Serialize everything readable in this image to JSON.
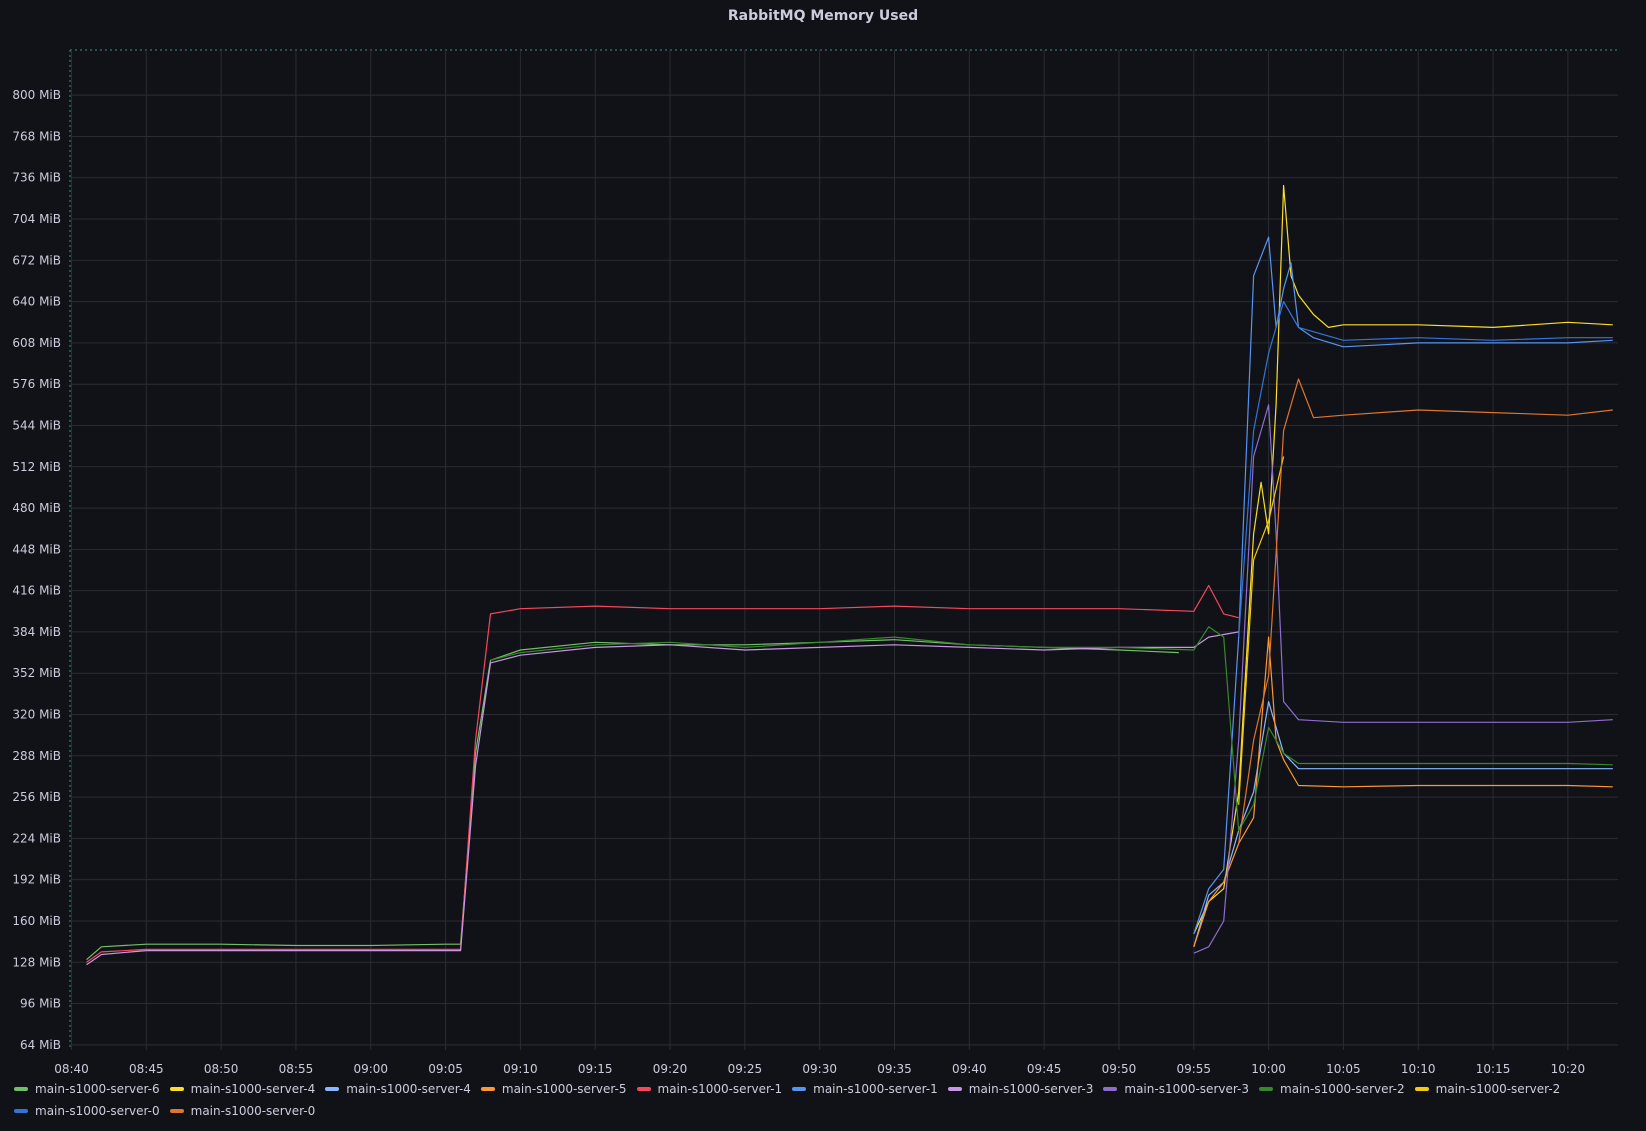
{
  "chart_data": {
    "type": "line",
    "title": "RabbitMQ Memory Used",
    "xlabel": "",
    "ylabel": "",
    "unit": "MiB",
    "ylim": [
      60,
      835
    ],
    "y_ticks": [
      "64 MiB",
      "96 MiB",
      "128 MiB",
      "160 MiB",
      "192 MiB",
      "224 MiB",
      "256 MiB",
      "288 MiB",
      "320 MiB",
      "352 MiB",
      "384 MiB",
      "416 MiB",
      "448 MiB",
      "480 MiB",
      "512 MiB",
      "544 MiB",
      "576 MiB",
      "608 MiB",
      "640 MiB",
      "672 MiB",
      "704 MiB",
      "736 MiB",
      "768 MiB",
      "800 MiB"
    ],
    "y_tick_values": [
      64,
      96,
      128,
      160,
      192,
      224,
      256,
      288,
      320,
      352,
      384,
      416,
      448,
      480,
      512,
      544,
      576,
      608,
      640,
      672,
      704,
      736,
      768,
      800
    ],
    "xlim": [
      "08:40",
      "10:23"
    ],
    "x_ticks": [
      "08:40",
      "08:45",
      "08:50",
      "08:55",
      "09:00",
      "09:05",
      "09:10",
      "09:15",
      "09:20",
      "09:25",
      "09:30",
      "09:35",
      "09:40",
      "09:45",
      "09:50",
      "09:55",
      "10:00",
      "10:05",
      "10:10",
      "10:15",
      "10:20"
    ],
    "grid": true,
    "legend_position": "bottom",
    "series": [
      {
        "name": "main-s1000-server-6",
        "color": "#73bf69",
        "x": [
          "08:41",
          "08:42",
          "08:45",
          "08:50",
          "08:55",
          "09:00",
          "09:05",
          "09:06",
          "09:07",
          "09:08",
          "09:10",
          "09:15",
          "09:20",
          "09:25",
          "09:30",
          "09:35",
          "09:40",
          "09:45",
          "09:50",
          "09:54"
        ],
        "values": [
          130,
          140,
          142,
          142,
          141,
          141,
          142,
          142,
          290,
          362,
          370,
          376,
          374,
          374,
          376,
          378,
          374,
          372,
          370,
          368
        ]
      },
      {
        "name": "main-s1000-server-4",
        "color": "#fade2a",
        "x": [
          "09:55",
          "09:56",
          "09:57",
          "09:58",
          "09:59",
          "09:59.5",
          "10:00",
          "10:00.5",
          "10:01",
          "10:01.5",
          "10:02",
          "10:03",
          "10:04",
          "10:05",
          "10:10",
          "10:15",
          "10:20",
          "10:23"
        ],
        "values": [
          150,
          175,
          185,
          260,
          460,
          500,
          460,
          560,
          730,
          660,
          645,
          630,
          620,
          622,
          622,
          620,
          624,
          622
        ]
      },
      {
        "name": "main-s1000-server-4",
        "color": "#8ab8ff",
        "x": [
          "09:55",
          "09:56",
          "09:57",
          "09:58",
          "09:59",
          "10:00",
          "10:01",
          "10:02",
          "10:05",
          "10:10",
          "10:15",
          "10:20",
          "10:23"
        ],
        "values": [
          140,
          180,
          190,
          230,
          260,
          330,
          290,
          278,
          278,
          278,
          278,
          278,
          278
        ]
      },
      {
        "name": "main-s1000-server-5",
        "color": "#ff9830",
        "x": [
          "09:55",
          "09:56",
          "09:57",
          "09:58",
          "09:59",
          "10:00",
          "10:00.5",
          "10:01",
          "10:02",
          "10:05",
          "10:10",
          "10:15",
          "10:20",
          "10:23"
        ],
        "values": [
          140,
          175,
          190,
          220,
          240,
          380,
          300,
          285,
          265,
          264,
          265,
          265,
          265,
          264
        ]
      },
      {
        "name": "main-s1000-server-1",
        "color": "#f2495c",
        "x": [
          "08:41",
          "08:42",
          "08:45",
          "08:50",
          "08:55",
          "09:00",
          "09:05",
          "09:06",
          "09:07",
          "09:08",
          "09:10",
          "09:15",
          "09:20",
          "09:25",
          "09:30",
          "09:35",
          "09:40",
          "09:45",
          "09:50",
          "09:55",
          "09:56",
          "09:57",
          "09:58"
        ],
        "values": [
          128,
          136,
          138,
          138,
          138,
          138,
          138,
          138,
          300,
          398,
          402,
          404,
          402,
          402,
          402,
          404,
          402,
          402,
          402,
          400,
          420,
          398,
          395
        ]
      },
      {
        "name": "main-s1000-server-1",
        "color": "#5794f2",
        "x": [
          "09:55",
          "09:56",
          "09:57",
          "09:58",
          "09:59",
          "10:00",
          "10:00.5",
          "10:01",
          "10:01.5",
          "10:02",
          "10:03",
          "10:05",
          "10:10",
          "10:15",
          "10:20",
          "10:23"
        ],
        "values": [
          150,
          185,
          200,
          380,
          660,
          690,
          620,
          650,
          670,
          620,
          612,
          605,
          608,
          608,
          608,
          610
        ]
      },
      {
        "name": "main-s1000-server-3",
        "color": "#ca95e5",
        "x": [
          "08:41",
          "08:42",
          "08:45",
          "08:50",
          "08:55",
          "09:00",
          "09:05",
          "09:06",
          "09:07",
          "09:08",
          "09:10",
          "09:15",
          "09:20",
          "09:25",
          "09:30",
          "09:35",
          "09:40",
          "09:45",
          "09:50",
          "09:55",
          "09:56",
          "09:57",
          "09:58"
        ],
        "values": [
          126,
          134,
          137,
          137,
          137,
          137,
          137,
          137,
          280,
          360,
          366,
          372,
          374,
          370,
          372,
          374,
          372,
          370,
          372,
          372,
          380,
          382,
          384
        ]
      },
      {
        "name": "main-s1000-server-3",
        "color": "#8f6dce",
        "x": [
          "09:55",
          "09:56",
          "09:57",
          "09:58",
          "09:59",
          "10:00",
          "10:00.5",
          "10:01",
          "10:02",
          "10:05",
          "10:10",
          "10:15",
          "10:20",
          "10:23"
        ],
        "values": [
          135,
          140,
          160,
          300,
          520,
          560,
          460,
          330,
          316,
          314,
          314,
          314,
          314,
          316
        ]
      },
      {
        "name": "main-s1000-server-2",
        "color": "#37872d",
        "x": [
          "09:08",
          "09:10",
          "09:15",
          "09:20",
          "09:25",
          "09:30",
          "09:35",
          "09:40",
          "09:45",
          "09:50",
          "09:55",
          "09:56",
          "09:57",
          "09:58",
          "09:59",
          "10:00",
          "10:01",
          "10:02",
          "10:05",
          "10:10",
          "10:15",
          "10:20",
          "10:23"
        ],
        "values": [
          362,
          368,
          374,
          376,
          372,
          376,
          380,
          374,
          372,
          372,
          370,
          388,
          380,
          230,
          250,
          310,
          290,
          282,
          282,
          282,
          282,
          282,
          281
        ]
      },
      {
        "name": "main-s1000-server-2",
        "color": "#f2cc0c",
        "x": [
          "09:58",
          "09:59",
          "10:00",
          "10:01"
        ],
        "values": [
          250,
          440,
          470,
          520
        ]
      },
      {
        "name": "main-s1000-server-0",
        "color": "#3274d9",
        "x": [
          "09:58",
          "09:59",
          "10:00",
          "10:01",
          "10:02",
          "10:05",
          "10:10",
          "10:15",
          "10:20",
          "10:23"
        ],
        "values": [
          380,
          540,
          600,
          640,
          620,
          610,
          612,
          610,
          612,
          612
        ]
      },
      {
        "name": "main-s1000-server-0",
        "color": "#e0752d",
        "x": [
          "09:58",
          "09:59",
          "10:00",
          "10:01",
          "10:02",
          "10:03",
          "10:05",
          "10:10",
          "10:15",
          "10:20",
          "10:23"
        ],
        "values": [
          220,
          300,
          350,
          540,
          580,
          550,
          552,
          556,
          554,
          552,
          556
        ]
      }
    ]
  }
}
